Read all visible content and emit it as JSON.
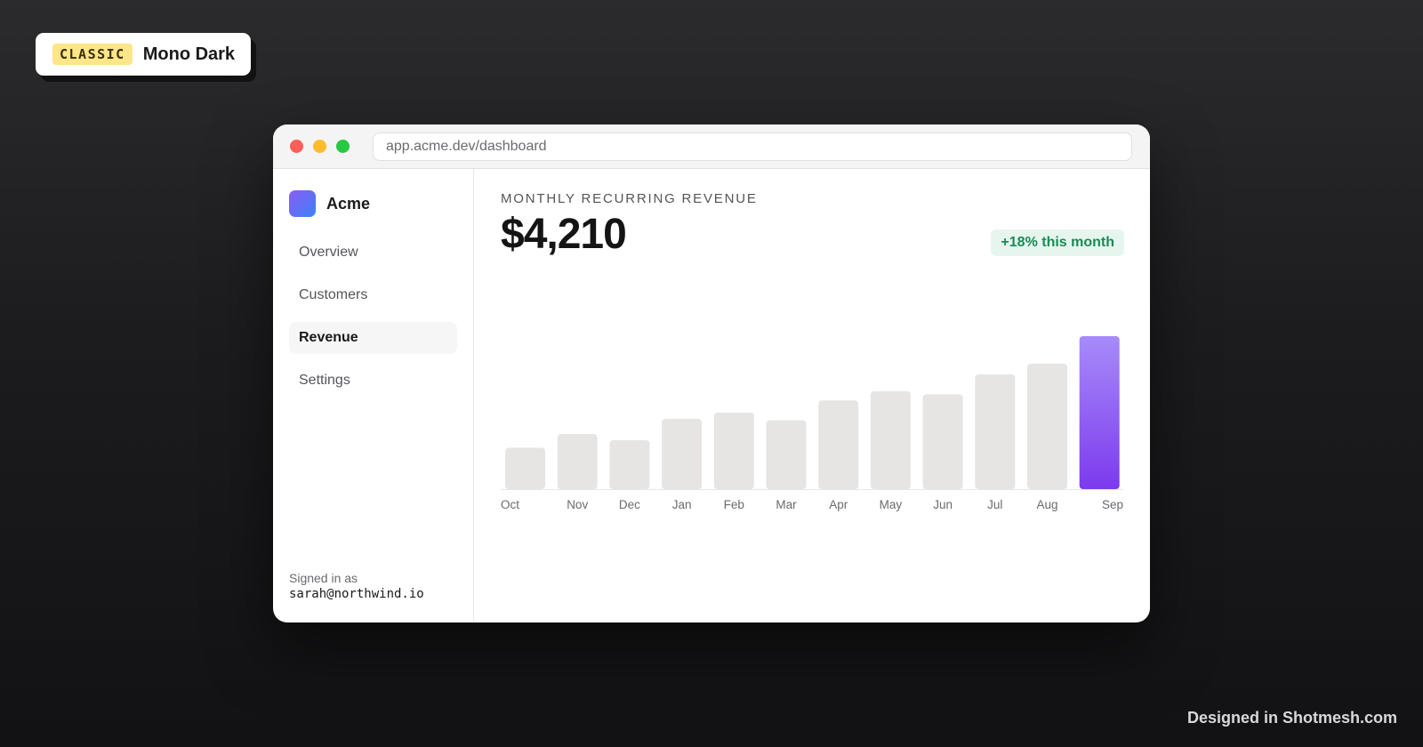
{
  "badge": {
    "tag": "CLASSIC",
    "title": "Mono Dark"
  },
  "browser": {
    "url": "app.acme.dev/dashboard"
  },
  "sidebar": {
    "brand": "Acme",
    "items": [
      {
        "label": "Overview",
        "active": false
      },
      {
        "label": "Customers",
        "active": false
      },
      {
        "label": "Revenue",
        "active": true
      },
      {
        "label": "Settings",
        "active": false
      }
    ],
    "signed_in_label": "Signed in as",
    "signed_in_email": "sarah@northwind.io"
  },
  "main": {
    "kicker": "MONTHLY RECURRING REVENUE",
    "amount": "$4,210",
    "delta": "+18% this month"
  },
  "chart_data": {
    "type": "bar",
    "categories": [
      "Oct",
      "Nov",
      "Dec",
      "Jan",
      "Feb",
      "Mar",
      "Apr",
      "May",
      "Jun",
      "Jul",
      "Aug",
      "Sep"
    ],
    "values": [
      0.27,
      0.36,
      0.32,
      0.46,
      0.5,
      0.45,
      0.58,
      0.64,
      0.62,
      0.75,
      0.82,
      1.0
    ],
    "highlight_index": 11,
    "ylim": [
      0,
      1
    ],
    "colors": {
      "bar": "#e6e5e4",
      "highlight_top": "#a78bfa",
      "highlight_bottom": "#7c3aed"
    },
    "grid": false
  },
  "footer": {
    "credit": "Designed in Shotmesh.com"
  }
}
